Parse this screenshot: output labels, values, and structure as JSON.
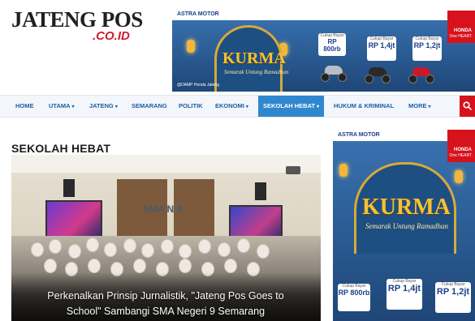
{
  "logo": {
    "main": "JATENG POS",
    "sub": ".CO.ID"
  },
  "nav": {
    "items": [
      {
        "label": "HOME",
        "dropdown": false
      },
      {
        "label": "UTAMA",
        "dropdown": true
      },
      {
        "label": "JATENG",
        "dropdown": true
      },
      {
        "label": "SEMARANG",
        "dropdown": false
      },
      {
        "label": "POLITIK",
        "dropdown": false
      },
      {
        "label": "EKONOMI",
        "dropdown": true
      },
      {
        "label": "SEKOLAH HEBAT",
        "dropdown": true,
        "active": true
      },
      {
        "label": "HUKUM & KRIMINAL",
        "dropdown": false
      },
      {
        "label": "MORE",
        "dropdown": true
      }
    ],
    "search_icon": "search-icon"
  },
  "section": {
    "title": "SEKOLAH HEBAT"
  },
  "featured": {
    "sign": "SMA N 9",
    "caption_line1": "Perkenalkan Prinsip Jurnalistik, \"Jateng Pos Goes to",
    "caption_line2": "School\" Sambangi SMA Negeri 9 Semarang"
  },
  "ads": {
    "brand": "ASTRA MOTOR",
    "honda": "HONDA",
    "honda_tagline": "One HEART.",
    "title": "KURMA",
    "tagline": "Semarak Untung Ramadhan",
    "price_label": "Cukup Bayar",
    "prices": [
      "RP 800rb",
      "RP 1,4jt",
      "RP 1,2jt"
    ],
    "footer": "@DAMP Honda Jateng"
  },
  "colors": {
    "nav_text": "#1d5da8",
    "nav_active": "#2f87cf",
    "brand_red": "#d6121d",
    "ad_blue": "#2e5f9a"
  }
}
